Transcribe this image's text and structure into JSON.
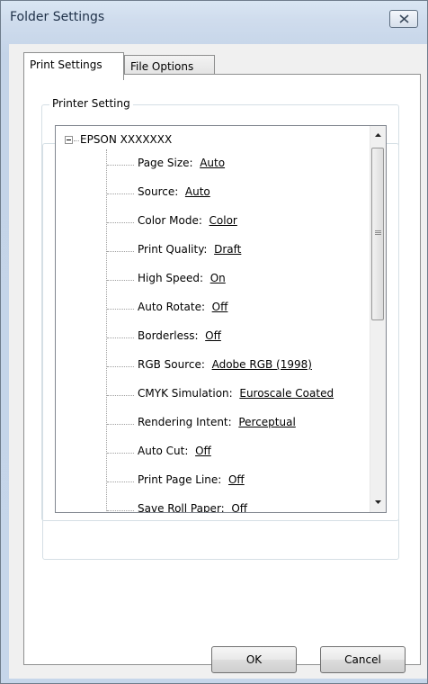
{
  "window": {
    "title": "Folder Settings"
  },
  "tabs": [
    {
      "label": "Print Settings",
      "active": true
    },
    {
      "label": "File Options",
      "active": false
    }
  ],
  "printer_setting": {
    "group_label": "Printer Setting",
    "printer_name": "EPSON XXXXXXX",
    "items": [
      {
        "label": "Page Size:",
        "value": "Auto"
      },
      {
        "label": "Source:",
        "value": "Auto"
      },
      {
        "label": "Color Mode:",
        "value": "Color"
      },
      {
        "label": "Print Quality:",
        "value": "Draft"
      },
      {
        "label": "High Speed:",
        "value": "On"
      },
      {
        "label": "Auto Rotate:",
        "value": "Off"
      },
      {
        "label": "Borderless:",
        "value": "Off"
      },
      {
        "label": "RGB Source:",
        "value": "Adobe RGB (1998)"
      },
      {
        "label": "CMYK Simulation:",
        "value": "Euroscale Coated"
      },
      {
        "label": "Rendering Intent:",
        "value": "Perceptual"
      },
      {
        "label": "Auto Cut:",
        "value": "Off"
      },
      {
        "label": "Print Page Line:",
        "value": "Off"
      },
      {
        "label": "Save Roll Paper:",
        "value": "Off"
      }
    ]
  },
  "buttons": {
    "ok": "OK",
    "cancel": "Cancel"
  }
}
